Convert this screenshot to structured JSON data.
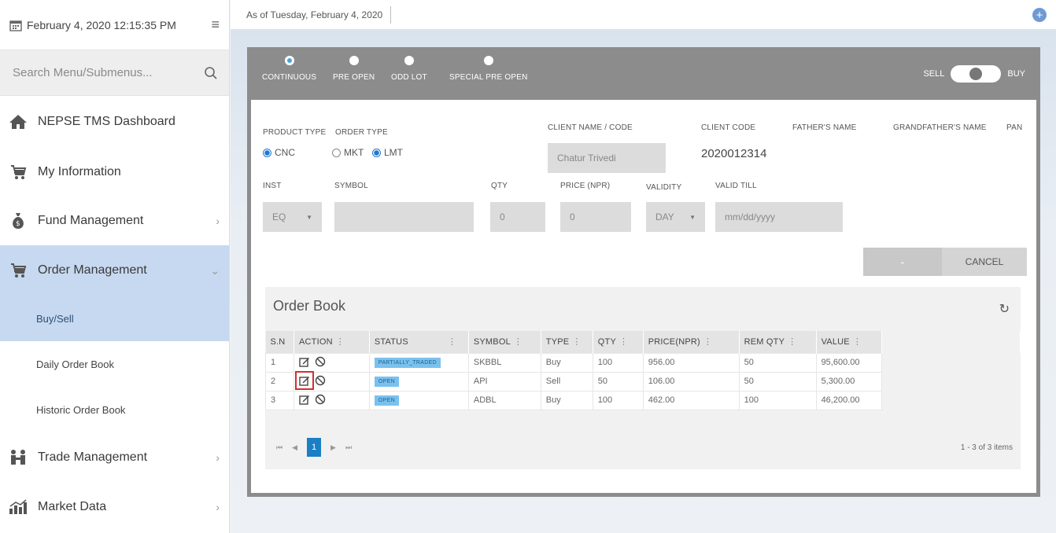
{
  "sidebar": {
    "datetime": "February 4, 2020 12:15:35 PM",
    "search_placeholder": "Search Menu/Submenus...",
    "items": [
      {
        "label": "NEPSE TMS Dashboard",
        "icon": "home-icon"
      },
      {
        "label": "My Information",
        "icon": "cart-icon"
      },
      {
        "label": "Fund Management",
        "icon": "money-bag-icon",
        "chevron": "›"
      },
      {
        "label": "Order Management",
        "icon": "cart-icon",
        "chevron": "⌄",
        "active": true
      },
      {
        "label": "Trade Management",
        "icon": "trade-icon",
        "chevron": "›"
      },
      {
        "label": "Market Data",
        "icon": "chart-icon",
        "chevron": "›"
      }
    ],
    "submenu": [
      {
        "label": "Buy/Sell",
        "active": true
      },
      {
        "label": "Daily Order Book"
      },
      {
        "label": "Historic Order Book"
      }
    ]
  },
  "topbar": {
    "as_of": "As of Tuesday, February 4, 2020",
    "plus": "+"
  },
  "order_form": {
    "market_types": [
      {
        "label": "CONTINUOUS",
        "selected": true
      },
      {
        "label": "PRE OPEN"
      },
      {
        "label": "ODD LOT"
      },
      {
        "label": "SPECIAL PRE OPEN"
      }
    ],
    "sell_label": "SELL",
    "buy_label": "BUY",
    "product_type_label": "PRODUCT TYPE",
    "product_type_option": "CNC",
    "order_type_label": "ORDER TYPE",
    "order_type_options": [
      "MKT",
      "LMT"
    ],
    "order_type_selected": "LMT",
    "client_name_label": "CLIENT NAME / CODE",
    "client_name_value": "Chatur Trivedi",
    "client_code_label": "CLIENT CODE",
    "client_code_value": "2020012314",
    "fathers_name_label": "FATHER'S NAME",
    "grandfathers_name_label": "GRANDFATHER'S NAME",
    "pan_label": "PAN",
    "inst_label": "INST",
    "inst_value": "EQ",
    "symbol_label": "SYMBOL",
    "qty_label": "QTY",
    "qty_value": "0",
    "price_label": "PRICE (NPR)",
    "price_value": "0",
    "validity_label": "VALIDITY",
    "validity_value": "DAY",
    "valid_till_label": "VALID TILL",
    "valid_till_placeholder": "mm/dd/yyyy",
    "dash_button": "-",
    "cancel_button": "CANCEL"
  },
  "order_book": {
    "title": "Order Book",
    "columns": [
      "S.N",
      "ACTION",
      "STATUS",
      "SYMBOL",
      "TYPE",
      "QTY",
      "PRICE(NPR)",
      "REM QTY",
      "VALUE"
    ],
    "rows": [
      {
        "sn": "1",
        "status": "PARTIALLY_TRADED",
        "symbol": "SKBBL",
        "type": "Buy",
        "qty": "100",
        "price": "956.00",
        "rem_qty": "50",
        "value": "95,600.00"
      },
      {
        "sn": "2",
        "status": "OPEN",
        "symbol": "API",
        "type": "Sell",
        "qty": "50",
        "price": "106.00",
        "rem_qty": "50",
        "value": "5,300.00"
      },
      {
        "sn": "3",
        "status": "OPEN",
        "symbol": "ADBL",
        "type": "Buy",
        "qty": "100",
        "price": "462.00",
        "rem_qty": "100",
        "value": "46,200.00"
      }
    ],
    "pager": {
      "first": "⏮",
      "prev": "◀",
      "current": "1",
      "next": "▶",
      "last": "⏭"
    },
    "items_text": "1 - 3 of 3 items"
  }
}
